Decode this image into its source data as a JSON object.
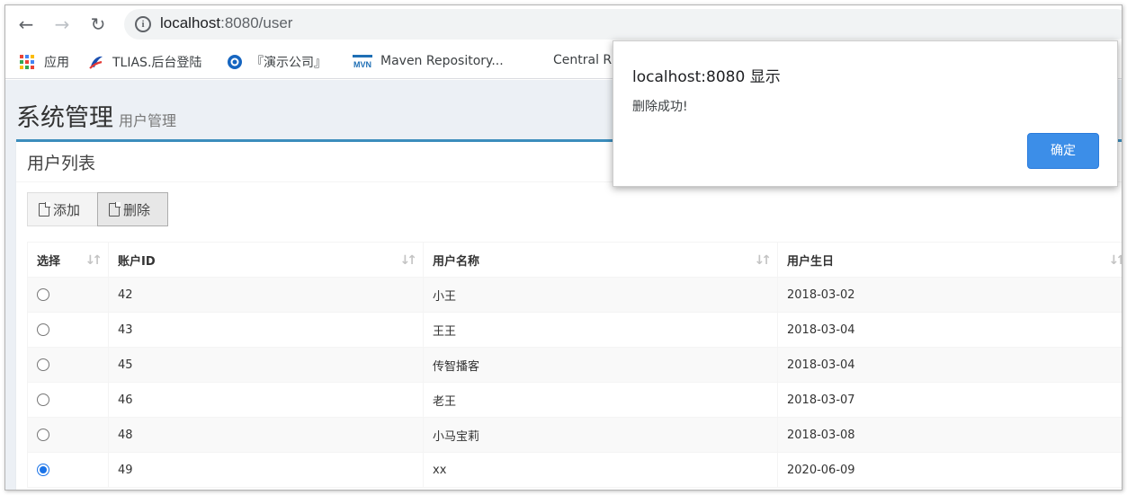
{
  "browser": {
    "url_host": "localhost",
    "url_rest": ":8080/user",
    "bookmarks": [
      {
        "label": "应用",
        "icon": "apps-grid-icon"
      },
      {
        "label": "TLIAS.后台登陆",
        "icon": "tlias-logo-icon"
      },
      {
        "label": "『演示公司』",
        "icon": "demo-company-icon"
      },
      {
        "label": "Maven Repository...",
        "icon": "mvn-icon"
      },
      {
        "label": "Central R",
        "icon": ""
      }
    ]
  },
  "page": {
    "title": "系统管理",
    "subtitle": "用户管理"
  },
  "box": {
    "title": "用户列表",
    "add_label": "添加",
    "delete_label": "删除"
  },
  "table": {
    "headers": [
      "选择",
      "账户ID",
      "用户名称",
      "用户生日"
    ],
    "rows": [
      {
        "selected": false,
        "id": "42",
        "name": "小王",
        "birthday": "2018-03-02"
      },
      {
        "selected": false,
        "id": "43",
        "name": "王王",
        "birthday": "2018-03-04"
      },
      {
        "selected": false,
        "id": "45",
        "name": "传智播客",
        "birthday": "2018-03-04"
      },
      {
        "selected": false,
        "id": "46",
        "name": "老王",
        "birthday": "2018-03-07"
      },
      {
        "selected": false,
        "id": "48",
        "name": "小马宝莉",
        "birthday": "2018-03-08"
      },
      {
        "selected": true,
        "id": "49",
        "name": "xx",
        "birthday": "2020-06-09"
      }
    ]
  },
  "dialog": {
    "title": "localhost:8080 显示",
    "message": "删除成功!",
    "ok_label": "确定"
  },
  "colors": {
    "accent": "#3c8dbc",
    "dialog_button": "#3c8ee8",
    "page_bg": "#ecf0f5"
  }
}
